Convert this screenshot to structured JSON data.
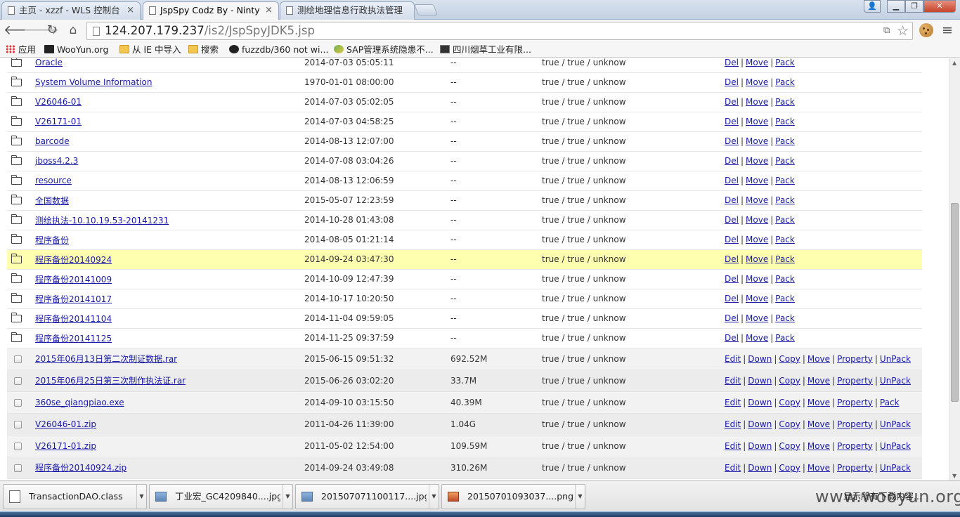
{
  "tabs": [
    {
      "title": "主页 - xzzf - WLS 控制台",
      "active": false
    },
    {
      "title": "JspSpy Codz By - Ninty",
      "active": true
    },
    {
      "title": "测绘地理信息行政执法管理",
      "active": false
    }
  ],
  "window_controls": {
    "close": "✕",
    "minimize": "▁",
    "maximize": "❐",
    "user": "👤"
  },
  "toolbar": {
    "url_host": "124.207.179.237",
    "url_path": "/is2/JspSpyJDK5.jsp"
  },
  "bookmarks": [
    {
      "label": "应用",
      "icon": "apps-grid-icon"
    },
    {
      "label": "WooYun.org",
      "icon": "wooyun-icon"
    },
    {
      "label": "从 IE 中导入",
      "icon": "folder-icon"
    },
    {
      "label": "搜索",
      "icon": "folder-icon"
    },
    {
      "label": "fuzzdb/360 not wi...",
      "icon": "github-icon"
    },
    {
      "label": "SAP管理系统隐患不...",
      "icon": "sap-icon"
    },
    {
      "label": "四川烟草工业有限...",
      "icon": "sichuan-icon"
    }
  ],
  "directories": [
    {
      "name": "Oracle",
      "date": "2014-07-03 05:05:11",
      "size": "--",
      "perm": "true / true / unknow"
    },
    {
      "name": "System Volume Information",
      "date": "1970-01-01 08:00:00",
      "size": "--",
      "perm": "true / true / unknow"
    },
    {
      "name": "V26046-01",
      "date": "2014-07-03 05:02:05",
      "size": "--",
      "perm": "true / true / unknow"
    },
    {
      "name": "V26171-01",
      "date": "2014-07-03 04:58:25",
      "size": "--",
      "perm": "true / true / unknow"
    },
    {
      "name": "barcode",
      "date": "2014-08-13 12:07:00",
      "size": "--",
      "perm": "true / true / unknow"
    },
    {
      "name": "jboss4.2.3",
      "date": "2014-07-08 03:04:26",
      "size": "--",
      "perm": "true / true / unknow"
    },
    {
      "name": "resource",
      "date": "2014-08-13 12:06:59",
      "size": "--",
      "perm": "true / true / unknow"
    },
    {
      "name": "全国数据",
      "date": "2015-05-07 12:23:59",
      "size": "--",
      "perm": "true / true / unknow"
    },
    {
      "name": "测绘执法-10.10.19.53-20141231",
      "date": "2014-10-28 01:43:08",
      "size": "--",
      "perm": "true / true / unknow"
    },
    {
      "name": "程序备份",
      "date": "2014-08-05 01:21:14",
      "size": "--",
      "perm": "true / true / unknow"
    },
    {
      "name": "程序备份20140924",
      "date": "2014-09-24 03:47:30",
      "size": "--",
      "perm": "true / true / unknow",
      "highlight": true
    },
    {
      "name": "程序备份20141009",
      "date": "2014-10-09 12:47:39",
      "size": "--",
      "perm": "true / true / unknow"
    },
    {
      "name": "程序备份20141017",
      "date": "2014-10-17 10:20:50",
      "size": "--",
      "perm": "true / true / unknow"
    },
    {
      "name": "程序备份20141104",
      "date": "2014-11-04 09:59:05",
      "size": "--",
      "perm": "true / true / unknow"
    },
    {
      "name": "程序备份20141125",
      "date": "2014-11-25 09:37:59",
      "size": "--",
      "perm": "true / true / unknow"
    }
  ],
  "dir_actions": [
    "Del",
    "Move",
    "Pack"
  ],
  "files": [
    {
      "name": "2015年06月13日第二次制证数据.rar",
      "date": "2015-06-15 09:51:32",
      "size": "692.52M",
      "perm": "true / true / unknow",
      "last_action": "UnPack"
    },
    {
      "name": "2015年06月25日第三次制作执法证.rar",
      "date": "2015-06-26 03:02:20",
      "size": "33.7M",
      "perm": "true / true / unknow",
      "last_action": "UnPack"
    },
    {
      "name": "360se_qiangpiao.exe",
      "date": "2014-09-10 03:15:50",
      "size": "40.39M",
      "perm": "true / true / unknow",
      "last_action": "Pack"
    },
    {
      "name": "V26046-01.zip",
      "date": "2011-04-26 11:39:00",
      "size": "1.04G",
      "perm": "true / true / unknow",
      "last_action": "UnPack"
    },
    {
      "name": "V26171-01.zip",
      "date": "2011-05-02 12:54:00",
      "size": "109.59M",
      "perm": "true / true / unknow",
      "last_action": "UnPack"
    },
    {
      "name": "程序备份20140924.zip",
      "date": "2014-09-24 03:49:08",
      "size": "310.26M",
      "perm": "true / true / unknow",
      "last_action": "UnPack"
    }
  ],
  "file_actions": [
    "Edit",
    "Down",
    "Copy",
    "Move",
    "Property"
  ],
  "downloads": [
    {
      "name": "TransactionDAO.class",
      "icon": "class-file-icon"
    },
    {
      "name": "丁业宏_GC4209840....jpg",
      "icon": "image-file-icon"
    },
    {
      "name": "201507071100117....jpg",
      "icon": "image-file-icon"
    },
    {
      "name": "20150701093037....png",
      "icon": "png-file-icon"
    }
  ],
  "shelf": {
    "show_all": "显示所有下载内容...",
    "watermark": "www.wooyun.org"
  }
}
